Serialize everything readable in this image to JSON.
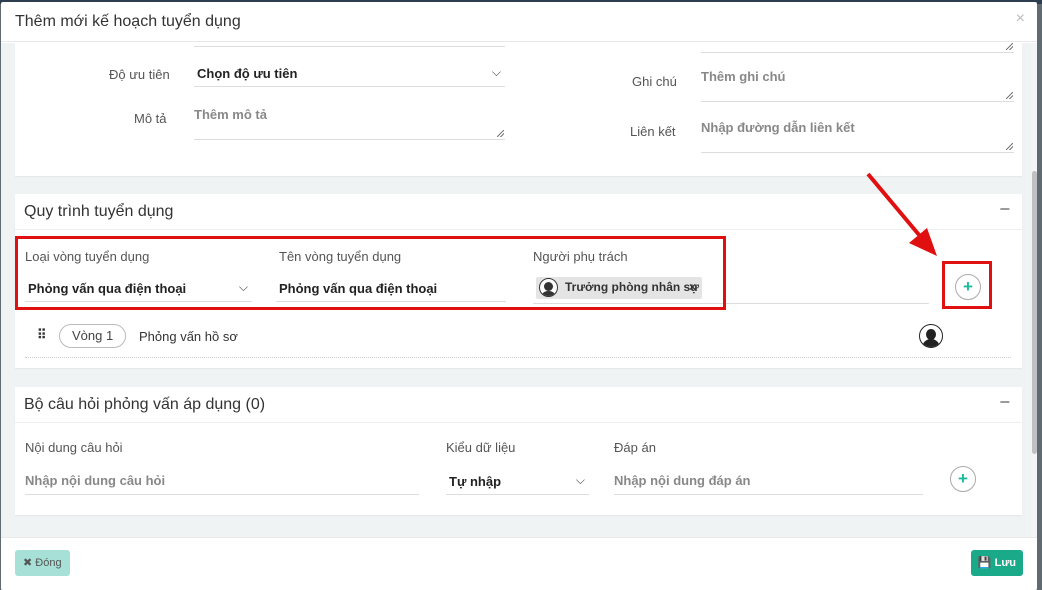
{
  "modal": {
    "title": "Thêm mới kế hoạch tuyển dụng",
    "close_icon": "×"
  },
  "general": {
    "priority_label": "Độ ưu tiên",
    "priority_value": "Chọn độ ưu tiên",
    "description_label": "Mô tả",
    "description_placeholder": "Thêm mô tả",
    "note_label": "Ghi chú",
    "note_placeholder": "Thêm ghi chú",
    "link_label": "Liên kết",
    "link_placeholder": "Nhập đường dẫn liên kết"
  },
  "process": {
    "title": "Quy trình tuyển dụng",
    "collapse_icon": "−",
    "round_type_label": "Loại vòng tuyển dụng",
    "round_type_value": "Phỏng vấn qua điện thoại",
    "round_name_label": "Tên vòng tuyển dụng",
    "round_name_value": "Phỏng vấn qua điện thoại",
    "owner_label": "Người phụ trách",
    "owner_chip": "Trưởng phòng nhân sự",
    "chip_remove": "×",
    "add_icon": "+",
    "rounds": [
      {
        "badge": "Vòng 1",
        "name": "Phỏng vấn hồ sơ"
      }
    ]
  },
  "questions": {
    "title": "Bộ câu hỏi phỏng vấn áp dụng (0)",
    "collapse_icon": "−",
    "content_label": "Nội dung câu hỏi",
    "content_placeholder": "Nhập nội dung câu hỏi",
    "datatype_label": "Kiểu dữ liệu",
    "datatype_value": "Tự nhập",
    "answer_label": "Đáp án",
    "answer_placeholder": "Nhập nội dung đáp án",
    "add_icon": "+"
  },
  "footer": {
    "close_label": "✖ Đóng",
    "save_label": "💾 Lưu"
  },
  "colors": {
    "accent": "#1aaa8a",
    "highlight": "#e01010"
  }
}
